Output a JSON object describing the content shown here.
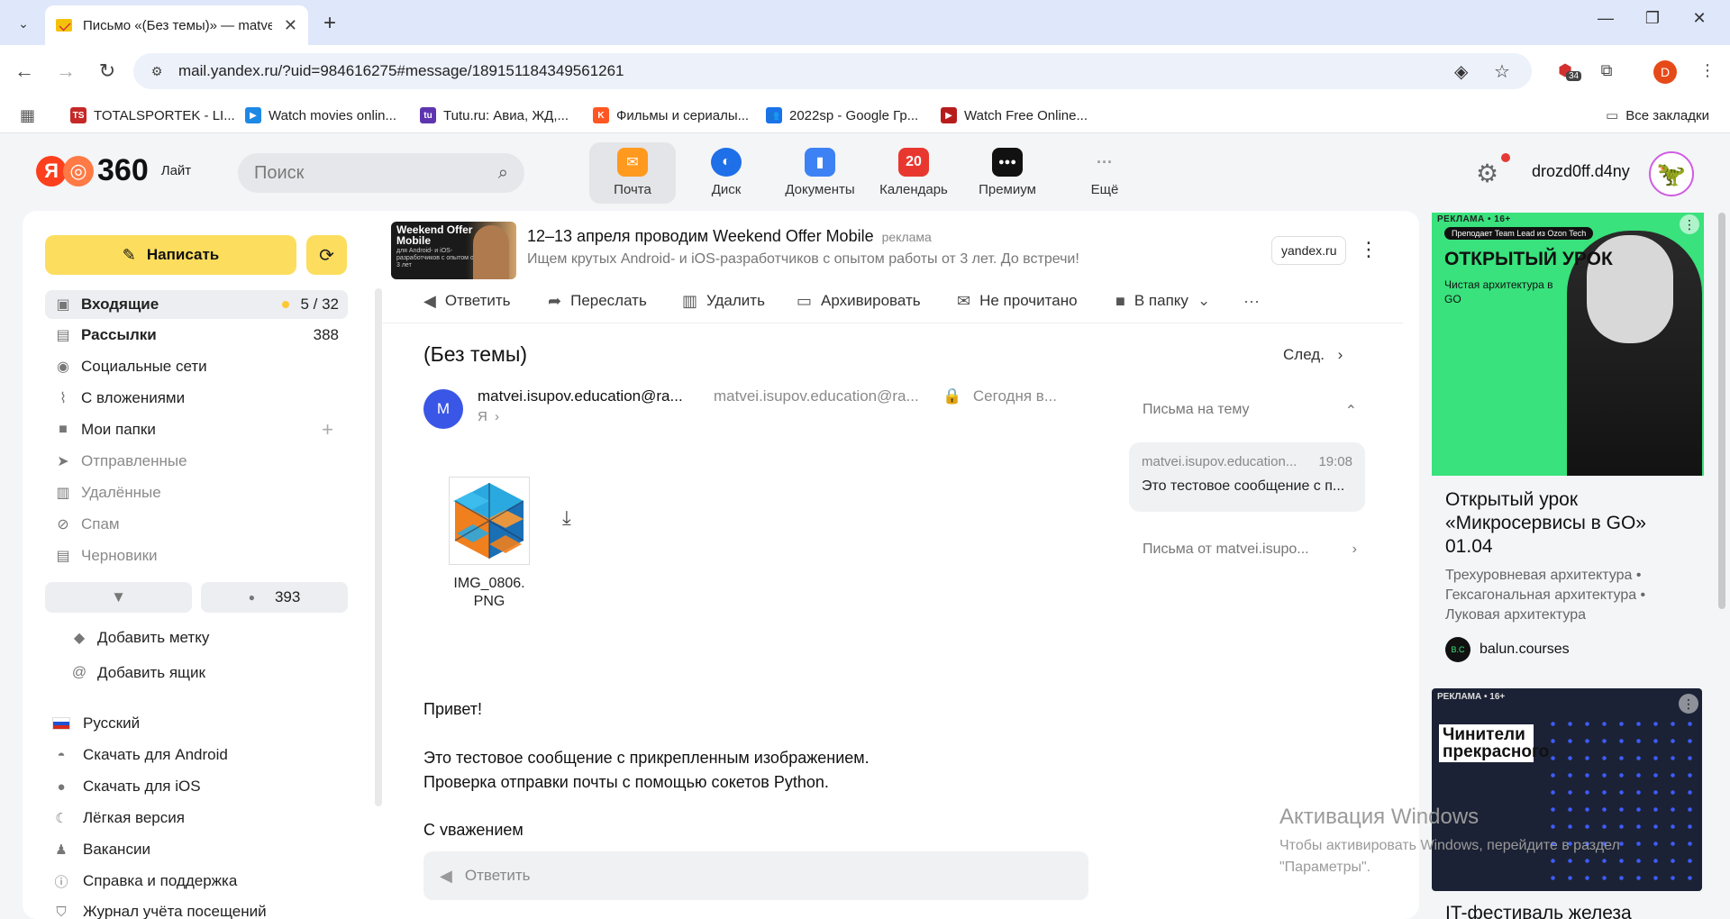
{
  "browser": {
    "tab_title": "Письмо «(Без темы)» — matve",
    "url": "mail.yandex.ru/?uid=984616275#message/189151184349561261",
    "ext_badge": "34",
    "profile_letter": "D",
    "bookmarks": [
      {
        "label": "TOTALSPORTEK - LI...",
        "icon": "TS",
        "color": "#c62828"
      },
      {
        "label": "Watch movies onlin...",
        "icon": "▶",
        "color": "#1e88e5"
      },
      {
        "label": "Tutu.ru: Авиа, ЖД,...",
        "icon": "tu",
        "color": "#5e35b1"
      },
      {
        "label": "Фильмы и сериалы...",
        "icon": "K",
        "color": "#ff5722"
      },
      {
        "label": "2022sp - Google Гр...",
        "icon": "👥",
        "color": "#1a73e8"
      },
      {
        "label": "Watch Free Online...",
        "icon": "▶",
        "color": "#b71c1c"
      }
    ],
    "all_bookmarks": "Все закладки"
  },
  "header": {
    "logo_text": "360",
    "logo_lite": "Лайт",
    "search_placeholder": "Поиск",
    "services": [
      {
        "label": "Почта",
        "color": "#ff9a1f",
        "glyph": "✉"
      },
      {
        "label": "Диск",
        "color": "#1e6fe8",
        "glyph": "◐"
      },
      {
        "label": "Документы",
        "color": "#3d82f5",
        "glyph": "▮"
      },
      {
        "label": "Календарь",
        "color": "#e8372f",
        "glyph": "20"
      },
      {
        "label": "Премиум",
        "color": "#111111",
        "glyph": "●●●"
      },
      {
        "label": "Ещё",
        "color": "transparent",
        "glyph": "···"
      }
    ],
    "username": "drozd0ff.d4ny"
  },
  "sidebar": {
    "compose": "Написать",
    "folders": [
      {
        "name": "Входящие",
        "count": "5 / 32",
        "icon": "▣"
      },
      {
        "name": "Рассылки",
        "count": "388",
        "icon": "▤"
      },
      {
        "name": "Социальные сети",
        "count": "",
        "icon": "💬"
      },
      {
        "name": "С вложениями",
        "count": "",
        "icon": "📎"
      },
      {
        "name": "Мои папки",
        "count": "",
        "icon": "■"
      },
      {
        "name": "Отправленные",
        "count": "",
        "icon": "➤"
      },
      {
        "name": "Удалённые",
        "count": "",
        "icon": "🗑"
      },
      {
        "name": "Спам",
        "count": "",
        "icon": "⊘"
      },
      {
        "name": "Черновики",
        "count": "",
        "icon": "▤"
      }
    ],
    "unread_chip": "393",
    "add_label": "Добавить метку",
    "add_mailbox": "Добавить ящик",
    "footer": [
      "Русский",
      "Скачать для Android",
      "Скачать для iOS",
      "Лёгкая версия",
      "Вакансии",
      "Справка и поддержка",
      "Журнал учёта посещений"
    ]
  },
  "ad_top": {
    "banner_title": "Weekend Offer Mobile",
    "banner_sub": "для Android- и iOS-разработчиков с опытом от 3 лет",
    "title": "12–13 апреля проводим Weekend Offer Mobile",
    "tag": "реклама",
    "subtitle": "Ищем крутых Android- и iOS-разработчиков с опытом работы от 3 лет. До встречи!",
    "domain": "yandex.ru"
  },
  "msg_toolbar": {
    "reply": "Ответить",
    "forward": "Переслать",
    "delete": "Удалить",
    "archive": "Архивировать",
    "unread": "Не прочитано",
    "to_folder": "В папку"
  },
  "message": {
    "subject": "(Без темы)",
    "next": "След.",
    "avatar_letter": "M",
    "sender_name": "matvei.isupov.education@ra...",
    "sender_addr": "matvei.isupov.education@ra...",
    "date": "Сегодня в...",
    "to": "Я",
    "attachment_name": "IMG_0806. PNG",
    "body": [
      "Привет!",
      "Это тестовое сообщение с прикрепленным изображением.",
      "Проверка отправки почты с помощью сокетов Python.",
      "С уважением"
    ],
    "reply_placeholder": "Ответить"
  },
  "thread": {
    "heading": "Письма на тему",
    "card_from": "matvei.isupov.education...",
    "card_time": "19:08",
    "card_preview": "Это тестовое сообщение с п...",
    "from_link": "Письма от matvei.isupo..."
  },
  "right_ads": {
    "ad1": {
      "badge": "РЕКЛАМА • 16+",
      "pill": "Преподает Team Lead из Ozon Tech",
      "headline": "ОТКРЫТЫЙ УРОК",
      "sub": "Чистая архитектура в GO",
      "title": "Открытый урок «Микросервисы в GO» 01.04",
      "desc": "Трехуровневая архитектура • Гексагональная архитектура • Луковая архитектура",
      "source": "balun.courses",
      "source_icon": "B.C"
    },
    "ad2": {
      "badge": "РЕКЛАМА • 16+",
      "headline": "Чинители прекрасного",
      "title": "IT-фестиваль железа"
    }
  },
  "windows_watermark": {
    "line1": "Активация Windows",
    "line2": "Чтобы активировать Windows, перейдите в раздел \"Параметры\"."
  }
}
